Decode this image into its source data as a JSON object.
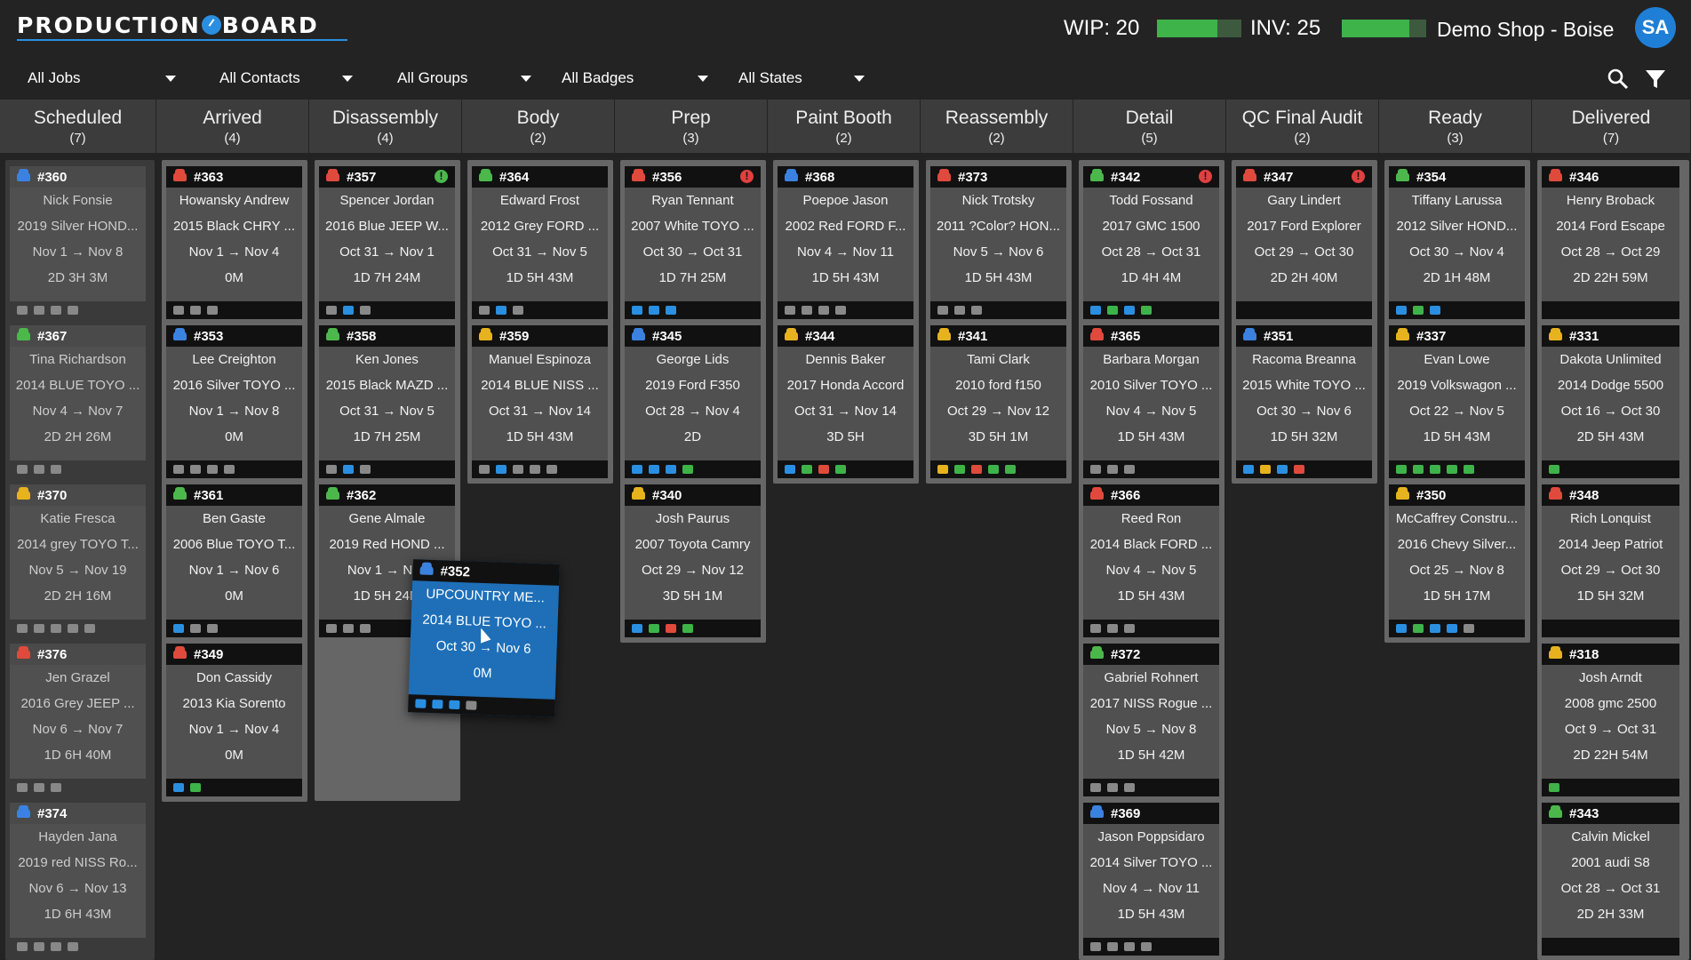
{
  "header": {
    "logo_part1": "PRODUCTION",
    "logo_part2": "BOARD",
    "wip_label": "WIP:",
    "wip_value": "20",
    "inv_label": "INV:",
    "inv_value": "25",
    "shop_name": "Demo Shop - Boise",
    "avatar_initials": "SA",
    "wip_level": 0.72,
    "inv_level": 0.8
  },
  "filters": [
    {
      "label": "All Jobs"
    },
    {
      "label": "All Contacts"
    },
    {
      "label": "All Groups"
    },
    {
      "label": "All Badges"
    },
    {
      "label": "All States"
    }
  ],
  "toolbar_icons": [
    "search-icon",
    "filter-icon"
  ],
  "columns": [
    {
      "name": "Scheduled",
      "count": "(7)",
      "cards": [
        {
          "num": "#360",
          "car": "blue",
          "l1": "Nick Fonsie",
          "l2": "2019 Silver HOND...",
          "l3": "Nov 1 → Nov 8",
          "l4": "2D 3H 3M",
          "style": "grey",
          "badges": [
            "w",
            "w",
            "w",
            "w"
          ]
        },
        {
          "num": "#367",
          "car": "green",
          "l1": "Tina Richardson",
          "l2": "2014 BLUE TOYO ...",
          "l3": "Nov 4 → Nov 7",
          "l4": "2D 2H 26M",
          "style": "grey",
          "badges": [
            "w",
            "w",
            "w"
          ]
        },
        {
          "num": "#370",
          "car": "yellow",
          "l1": "Katie Fresca",
          "l2": "2014 grey TOYO T...",
          "l3": "Nov 5 → Nov 19",
          "l4": "2D 2H 16M",
          "style": "grey",
          "badges": [
            "w",
            "w",
            "w",
            "w",
            "w"
          ]
        },
        {
          "num": "#376",
          "car": "red",
          "l1": "Jen Grazel",
          "l2": "2016 Grey JEEP ...",
          "l3": "Nov 6 → Nov 7",
          "l4": "1D 6H 40M",
          "style": "grey",
          "badges": [
            "w",
            "w",
            "w"
          ]
        },
        {
          "num": "#374",
          "car": "blue",
          "l1": "Hayden Jana",
          "l2": "2019 red NISS Ro...",
          "l3": "Nov 6 → Nov 13",
          "l4": "1D 6H 43M",
          "style": "grey",
          "badges": [
            "w",
            "w",
            "w",
            "w"
          ]
        }
      ]
    },
    {
      "name": "Arrived",
      "count": "(4)",
      "cards": [
        {
          "num": "#363",
          "car": "red",
          "l1": "Howansky Andrew",
          "l2": "2015 Black CHRY ...",
          "l3": "Nov 1 → Nov 4",
          "l4": "0M",
          "badges": [
            "w",
            "w",
            "w"
          ]
        },
        {
          "num": "#353",
          "car": "blue",
          "l1": "Lee Creighton",
          "l2": "2016 Silver TOYO ...",
          "l3": "Nov 1 → Nov 8",
          "l4": "0M",
          "badges": [
            "w",
            "w",
            "w",
            "w"
          ]
        },
        {
          "num": "#361",
          "car": "green",
          "l1": "Ben Gaste",
          "l2": "2006 Blue TOYO T...",
          "l3": "Nov 1 → Nov 6",
          "l4": "0M",
          "badges": [
            "b",
            "w",
            "w"
          ]
        },
        {
          "num": "#349",
          "car": "red",
          "l1": "Don Cassidy",
          "l2": "2013 Kia Sorento",
          "l3": "Nov 1 → Nov 4",
          "l4": "0M",
          "badges": [
            "b",
            "g"
          ]
        }
      ]
    },
    {
      "name": "Disassembly",
      "count": "(4)",
      "cards": [
        {
          "num": "#357",
          "car": "red",
          "l1": "Spencer Jordan",
          "l2": "2016 Blue JEEP W...",
          "l3": "Oct 31 → Nov 1",
          "l4": "1D 7H 24M",
          "alert": "green",
          "badges": [
            "w",
            "b",
            "w"
          ]
        },
        {
          "num": "#358",
          "car": "green",
          "l1": "Ken Jones",
          "l2": "2015 Black MAZD ...",
          "l3": "Oct 31 → Nov 5",
          "l4": "1D 7H 25M",
          "badges": [
            "w",
            "b",
            "w"
          ]
        },
        {
          "num": "#362",
          "car": "green",
          "l1": "Gene Almale",
          "l2": "2019 Red HOND ...",
          "l3": "Nov 1 → Nov",
          "l4": "1D 5H 24M",
          "badges": [
            "w",
            "w",
            "w"
          ]
        }
      ]
    },
    {
      "name": "Body",
      "count": "(2)",
      "cards": [
        {
          "num": "#364",
          "car": "green",
          "l1": "Edward Frost",
          "l2": "2012 Grey FORD ...",
          "l3": "Oct 31 → Nov 5",
          "l4": "1D 5H 43M",
          "badges": [
            "w",
            "b",
            "w"
          ]
        },
        {
          "num": "#359",
          "car": "yellow",
          "l1": "Manuel Espinoza",
          "l2": "2014 BLUE NISS ...",
          "l3": "Oct 31 → Nov 14",
          "l4": "1D 5H 43M",
          "badges": [
            "w",
            "b",
            "w",
            "w",
            "w"
          ]
        }
      ]
    },
    {
      "name": "Prep",
      "count": "(3)",
      "cards": [
        {
          "num": "#356",
          "car": "red",
          "l1": "Ryan Tennant",
          "l2": "2007 White TOYO ...",
          "l3": "Oct 30 → Oct 31",
          "l4": "1D 7H 25M",
          "alert": "red",
          "badges": [
            "b",
            "b",
            "b"
          ]
        },
        {
          "num": "#345",
          "car": "blue",
          "l1": "George Lids",
          "l2": "2019 Ford F350",
          "l3": "Oct 28 → Nov 4",
          "l4": "2D",
          "badges": [
            "b",
            "b",
            "b",
            "g"
          ]
        },
        {
          "num": "#340",
          "car": "yellow",
          "l1": "Josh Paurus",
          "l2": "2007 Toyota Camry",
          "l3": "Oct 29 → Nov 12",
          "l4": "3D 5H 1M",
          "badges": [
            "b",
            "g",
            "r",
            "g"
          ]
        }
      ]
    },
    {
      "name": "Paint Booth",
      "count": "(2)",
      "cards": [
        {
          "num": "#368",
          "car": "blue",
          "l1": "Poepoe Jason",
          "l2": "2002 Red FORD F...",
          "l3": "Nov 4 → Nov 11",
          "l4": "1D 5H 43M",
          "badges": [
            "w",
            "w",
            "w",
            "w"
          ]
        },
        {
          "num": "#344",
          "car": "yellow",
          "l1": "Dennis Baker",
          "l2": "2017 Honda Accord",
          "l3": "Oct 31 → Nov 14",
          "l4": "3D 5H",
          "badges": [
            "b",
            "g",
            "r",
            "g"
          ]
        }
      ]
    },
    {
      "name": "Reassembly",
      "count": "(2)",
      "cards": [
        {
          "num": "#373",
          "car": "red",
          "l1": "Nick Trotsky",
          "l2": "2011 ?Color? HON...",
          "l3": "Nov 5 → Nov 6",
          "l4": "1D 5H 43M",
          "badges": [
            "w",
            "w",
            "w"
          ]
        },
        {
          "num": "#341",
          "car": "yellow",
          "l1": "Tami Clark",
          "l2": "2010 ford f150",
          "l3": "Oct 29 → Nov 12",
          "l4": "3D 5H 1M",
          "badges": [
            "y",
            "g",
            "r",
            "g",
            "g"
          ]
        }
      ]
    },
    {
      "name": "Detail",
      "count": "(5)",
      "cards": [
        {
          "num": "#342",
          "car": "green",
          "l1": "Todd Fossand",
          "l2": "2017 GMC 1500",
          "l3": "Oct 28 → Oct 31",
          "l4": "1D 4H 4M",
          "alert": "red",
          "badges": [
            "b",
            "g",
            "b",
            "g"
          ]
        },
        {
          "num": "#365",
          "car": "red",
          "l1": "Barbara Morgan",
          "l2": "2010 Silver TOYO ...",
          "l3": "Nov 4 → Nov 5",
          "l4": "1D 5H 43M",
          "badges": [
            "w",
            "w",
            "w"
          ]
        },
        {
          "num": "#366",
          "car": "red",
          "l1": "Reed Ron",
          "l2": "2014 Black FORD ...",
          "l3": "Nov 4 → Nov 5",
          "l4": "1D 5H 43M",
          "badges": [
            "w",
            "w",
            "w"
          ]
        },
        {
          "num": "#372",
          "car": "green",
          "l1": "Gabriel Rohnert",
          "l2": "2017 NISS Rogue ...",
          "l3": "Nov 5 → Nov 8",
          "l4": "1D 5H 42M",
          "badges": [
            "w",
            "w",
            "w"
          ]
        },
        {
          "num": "#369",
          "car": "blue",
          "l1": "Jason Poppsidaro",
          "l2": "2014 Silver TOYO ...",
          "l3": "Nov 4 → Nov 11",
          "l4": "1D 5H 43M",
          "badges": [
            "w",
            "w",
            "w",
            "w"
          ]
        }
      ]
    },
    {
      "name": "QC Final Audit",
      "count": "(2)",
      "cards": [
        {
          "num": "#347",
          "car": "red",
          "l1": "Gary Lindert",
          "l2": "2017 Ford Explorer",
          "l3": "Oct 29 → Oct 30",
          "l4": "2D 2H 40M",
          "alert": "red",
          "badges": []
        },
        {
          "num": "#351",
          "car": "blue",
          "l1": "Racoma Breanna",
          "l2": "2015 White TOYO ...",
          "l3": "Oct 30 → Nov 6",
          "l4": "1D 5H 32M",
          "badges": [
            "b",
            "y",
            "b",
            "r"
          ]
        }
      ]
    },
    {
      "name": "Ready",
      "count": "(3)",
      "cards": [
        {
          "num": "#354",
          "car": "green",
          "l1": "Tiffany Larussa",
          "l2": "2012 Silver HOND...",
          "l3": "Oct 30 → Nov 4",
          "l4": "2D 1H 48M",
          "badges": [
            "b",
            "g",
            "b"
          ]
        },
        {
          "num": "#337",
          "car": "yellow",
          "l1": "Evan Lowe",
          "l2": "2019 Volkswagon ...",
          "l3": "Oct 22 → Nov 5",
          "l4": "1D 5H 43M",
          "badges": [
            "g",
            "g",
            "g",
            "g",
            "g"
          ]
        },
        {
          "num": "#350",
          "car": "yellow",
          "l1": "McCaffrey Constru...",
          "l2": "2016 Chevy Silver...",
          "l3": "Oct 25 → Nov 8",
          "l4": "1D 5H 17M",
          "badges": [
            "b",
            "g",
            "b",
            "b",
            "w"
          ]
        }
      ]
    },
    {
      "name": "Delivered",
      "count": "(7)",
      "cards": [
        {
          "num": "#346",
          "car": "red",
          "l1": "Henry Broback",
          "l2": "2014 Ford Escape",
          "l3": "Oct 28 → Oct 29",
          "l4": "2D 22H 59M",
          "badges": []
        },
        {
          "num": "#331",
          "car": "yellow",
          "l1": "Dakota Unlimited",
          "l2": "2014 Dodge 5500",
          "l3": "Oct 16 → Oct 30",
          "l4": "2D 5H 43M",
          "badges": [
            "g"
          ]
        },
        {
          "num": "#348",
          "car": "red",
          "l1": "Rich Lonquist",
          "l2": "2014 Jeep Patriot",
          "l3": "Oct 29 → Oct 30",
          "l4": "1D 5H 32M",
          "badges": []
        },
        {
          "num": "#318",
          "car": "yellow",
          "l1": "Josh Arndt",
          "l2": "2008 gmc 2500",
          "l3": "Oct 9 → Oct 31",
          "l4": "2D 22H 54M",
          "badges": [
            "g"
          ]
        },
        {
          "num": "#343",
          "car": "green",
          "l1": "Calvin Mickel",
          "l2": "2001 audi S8",
          "l3": "Oct 28 → Oct 31",
          "l4": "2D 2H 33M",
          "badges": []
        }
      ]
    }
  ],
  "dragged_card": {
    "num": "#352",
    "car": "blue",
    "l1": "UPCOUNTRY ME...",
    "l2": "2014 BLUE TOYO ...",
    "l3": "Oct 30 → Nov 6",
    "l4": "0M",
    "badges": [
      "b",
      "b",
      "b",
      "w"
    ]
  }
}
